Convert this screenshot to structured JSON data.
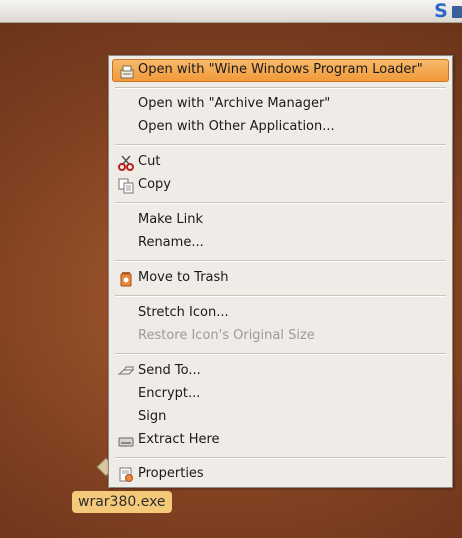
{
  "panel": {
    "app_icon": "S",
    "network_icon": "network-icon"
  },
  "desktop": {
    "file_name": "wrar380.exe"
  },
  "menu": {
    "items": [
      {
        "label": "Open with \"Wine Windows Program Loader\"",
        "icon": "wine-icon",
        "highlighted": true
      },
      {
        "label": "Open with \"Archive Manager\""
      },
      {
        "label": "Open with Other Application..."
      },
      {
        "label": "Cut",
        "icon": "scissors-icon"
      },
      {
        "label": "Copy",
        "icon": "copy-icon"
      },
      {
        "label": "Make Link"
      },
      {
        "label": "Rename..."
      },
      {
        "label": "Move to Trash",
        "icon": "trash-icon"
      },
      {
        "label": "Stretch Icon..."
      },
      {
        "label": "Restore Icon's Original Size",
        "disabled": true
      },
      {
        "label": "Send To...",
        "icon": "send-icon"
      },
      {
        "label": "Encrypt..."
      },
      {
        "label": "Sign"
      },
      {
        "label": "Extract Here",
        "icon": "extract-icon"
      },
      {
        "label": "Properties",
        "icon": "properties-icon"
      }
    ]
  },
  "colors": {
    "highlight": "#f19a3a",
    "desktop": "#8e4a27",
    "label_bg": "#f5c97a"
  }
}
